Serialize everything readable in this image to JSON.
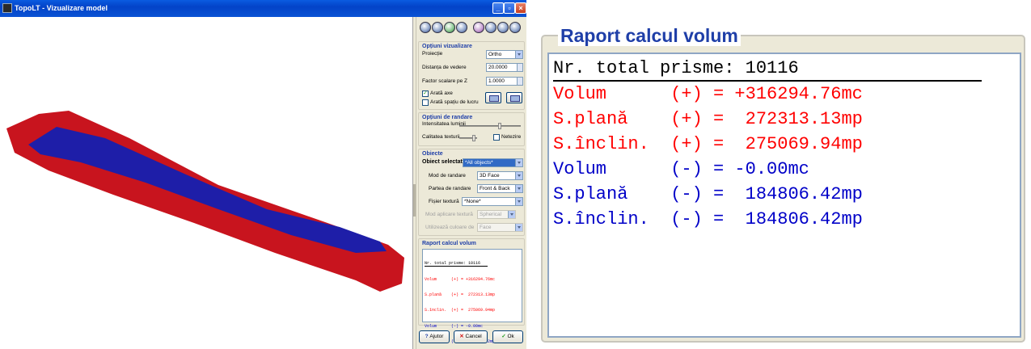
{
  "window": {
    "title": "TopoLT - Vizualizare model"
  },
  "colors": {
    "fill_positive": "#c8141e",
    "fill_negative": "#1e1ea8",
    "text_positive": "#ff0000",
    "text_negative": "#0000c8",
    "heading": "#1f3fa8"
  },
  "toolbar_icons": [
    "view-icon-1",
    "view-icon-2",
    "view-icon-3",
    "view-icon-4",
    "view-icon-5",
    "view-icon-6",
    "zoom-icon",
    "pan-icon"
  ],
  "options_view": {
    "title": "Opțiuni vizualizare",
    "projection_label": "Proiecție",
    "projection_value": "Ortho",
    "distance_label": "Distanța de vedere",
    "distance_value": "20.0000",
    "zscale_label": "Factor scalare pe Z",
    "zscale_value": "1.0000",
    "show_axes_label": "Arată axe",
    "show_axes_checked": true,
    "show_workspace_label": "Arată spațiu de lucru",
    "show_workspace_checked": false
  },
  "options_render": {
    "title": "Opțiuni de randare",
    "light_label": "Intensitatea luminii",
    "texture_label": "Calitatea texturii",
    "smooth_label": "Netezire"
  },
  "objects": {
    "title": "Obiecte",
    "selected_label": "Obiect selectat",
    "selected_value": "*All objects*",
    "render_mode_label": "Mod de randare",
    "render_mode_value": "3D Face",
    "render_side_label": "Partea de randare",
    "render_side_value": "Front & Back",
    "texture_file_label": "Fișier textură",
    "texture_file_value": "*None*",
    "texture_apply_label": "Mod aplicare textură",
    "texture_apply_value": "Spherical",
    "color_use_label": "Utilizează culoare de",
    "color_use_value": "Face"
  },
  "report": {
    "title": "Raport calcul volum",
    "lines": [
      "Nr. total prisme: 10116",
      "Volum      (+) = +316294.76mc",
      "S.plană    (+) =  272313.13mp",
      "S.înclin.  (+) =  275069.94mp",
      "Volum      (-) = -0.00mc",
      "S.plană    (-) =  184806.42mp",
      "S.înclin.  (-) =  184806.42mp"
    ]
  },
  "buttons": {
    "help": "Ajutor",
    "cancel": "Cancel",
    "ok": "Ok"
  }
}
